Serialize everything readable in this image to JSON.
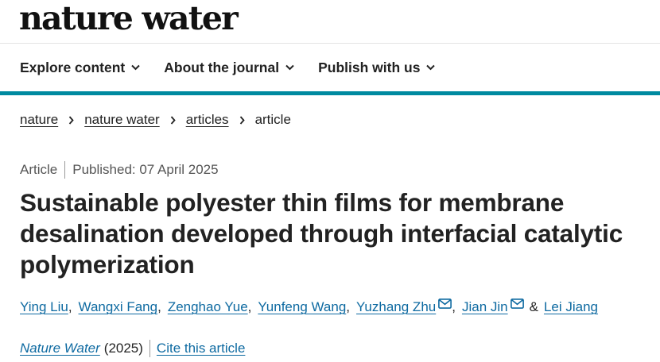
{
  "site": {
    "logo": "nature water"
  },
  "nav": {
    "items": [
      {
        "label": "Explore content",
        "icon": "chevron-down-icon"
      },
      {
        "label": "About the journal",
        "icon": "chevron-down-icon"
      },
      {
        "label": "Publish with us",
        "icon": "chevron-down-icon"
      }
    ]
  },
  "breadcrumb": {
    "items": [
      "nature",
      "nature water",
      "articles"
    ],
    "current": "article"
  },
  "article": {
    "type": "Article",
    "published": "Published: 07 April 2025",
    "title": "Sustainable polyester thin films for membrane desalination developed through interfacial catalytic polymerization",
    "authors": [
      "Ying Liu",
      "Wangxi Fang",
      "Zenghao Yue",
      "Yunfeng Wang",
      "Yuzhang Zhu",
      "Jian Jin",
      "Lei Jiang"
    ],
    "author_separator": "&",
    "journal": "Nature Water",
    "year": "(2025)",
    "cite_label": "Cite this article"
  },
  "colors": {
    "accent": "#008aa0",
    "link": "#0e6aa1",
    "text": "#222222"
  }
}
